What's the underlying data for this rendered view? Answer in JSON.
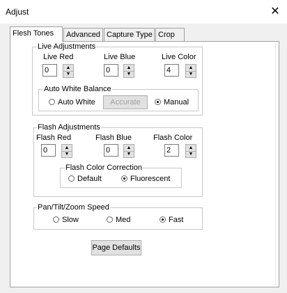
{
  "window": {
    "title": "Adjust",
    "close_glyph": "✕"
  },
  "tabs": [
    {
      "label": "Flesh Tones",
      "active": true
    },
    {
      "label": "Advanced",
      "active": false
    },
    {
      "label": "Capture Type",
      "active": false
    },
    {
      "label": "Crop",
      "active": false
    }
  ],
  "live": {
    "group_label": "Live Adjustments",
    "red_label": "Live Red",
    "red_value": "0",
    "blue_label": "Live Blue",
    "blue_value": "0",
    "color_label": "Live Color",
    "color_value": "4",
    "awb_label": "Auto White Balance",
    "auto_white_label": "Auto White",
    "accurate_label": "Accurate",
    "manual_label": "Manual",
    "selected": "Manual"
  },
  "flash": {
    "group_label": "Flash Adjustments",
    "red_label": "Flash Red",
    "red_value": "0",
    "blue_label": "Flash Blue",
    "blue_value": "0",
    "color_label": "Flash Color",
    "color_value": "2",
    "correction_label": "Flash Color Correction",
    "default_label": "Default",
    "fluorescent_label": "Fluorescent",
    "selected": "Fluorescent"
  },
  "ptz": {
    "group_label": "Pan/Tilt/Zoom Speed",
    "slow_label": "Slow",
    "med_label": "Med",
    "fast_label": "Fast",
    "selected": "Fast"
  },
  "page_defaults_label": "Page Defaults",
  "icons": {
    "spin_up": "▲",
    "spin_down": "▼"
  }
}
